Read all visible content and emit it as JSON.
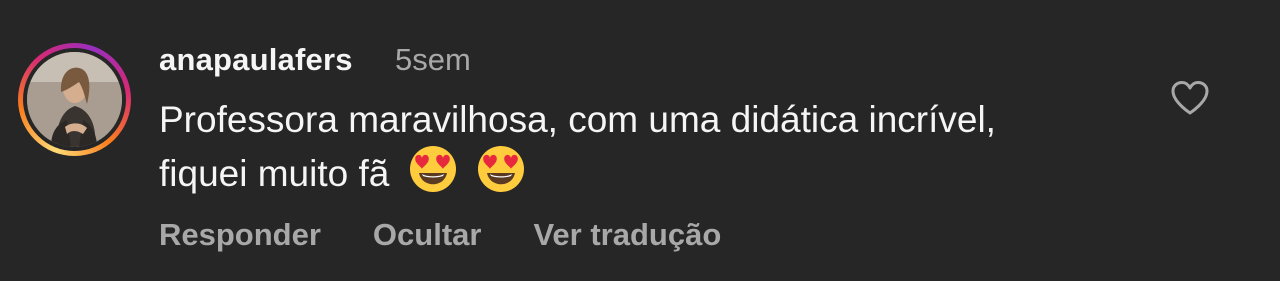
{
  "comment": {
    "username": "anapaulafers",
    "timestamp": "5sem",
    "text": "Professora maravilhosa, com uma didática incrível, fiquei muito fã",
    "emojis": [
      "heart-eyes-emoji",
      "heart-eyes-emoji"
    ],
    "like_icon": "heart-outline-icon"
  },
  "actions": {
    "reply_label": "Responder",
    "hide_label": "Ocultar",
    "translate_label": "Ver tradução"
  },
  "colors": {
    "background": "#262626",
    "primary_text": "#f5f5f5",
    "secondary_text": "#a8a8a8",
    "story_ring": [
      "#feda75",
      "#fa7e1e",
      "#d62976",
      "#962fbf"
    ]
  }
}
